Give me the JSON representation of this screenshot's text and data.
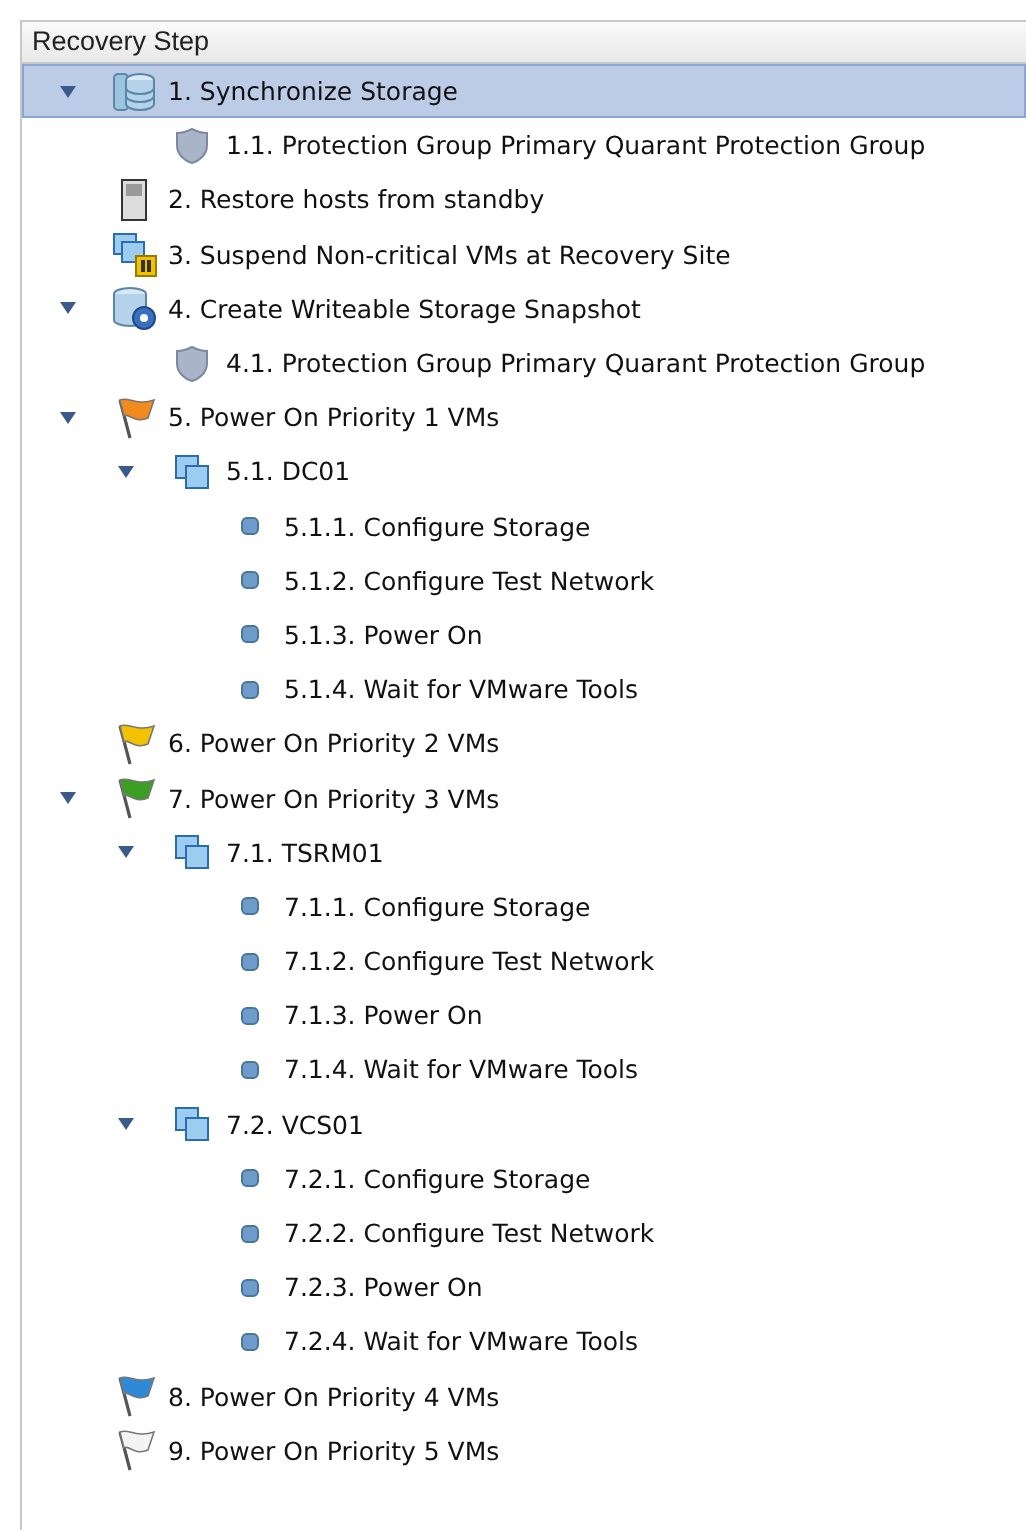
{
  "tree": {
    "column_header": "Recovery Step",
    "items": [
      {
        "label": "1. Synchronize Storage",
        "kind": "storage",
        "selected": true,
        "expanded": true,
        "children": [
          {
            "label": "1.1. Protection Group Primary Quarant Protection Group",
            "kind": "shield",
            "selected": false,
            "expanded": false
          }
        ]
      },
      {
        "label": "2. Restore hosts from standby",
        "kind": "host",
        "selected": false,
        "expanded": false
      },
      {
        "label": "3. Suspend Non-critical VMs at Recovery Site",
        "kind": "suspend",
        "selected": false,
        "expanded": false
      },
      {
        "label": "4. Create Writeable Storage Snapshot",
        "kind": "snapshot",
        "selected": false,
        "expanded": true,
        "children": [
          {
            "label": "4.1. Protection Group Primary Quarant Protection Group",
            "kind": "shield",
            "selected": false,
            "expanded": false
          }
        ]
      },
      {
        "label": "5. Power On Priority 1 VMs",
        "kind": "flag",
        "color": "#f28a1e",
        "selected": false,
        "expanded": true,
        "children": [
          {
            "label": "5.1. DC01",
            "kind": "vm",
            "selected": false,
            "expanded": true,
            "children": [
              {
                "label": "5.1.1. Configure Storage",
                "kind": "step",
                "selected": false,
                "expanded": false
              },
              {
                "label": "5.1.2. Configure Test Network",
                "kind": "step",
                "selected": false,
                "expanded": false
              },
              {
                "label": "5.1.3. Power On",
                "kind": "step",
                "selected": false,
                "expanded": false
              },
              {
                "label": "5.1.4. Wait for VMware Tools",
                "kind": "step",
                "selected": false,
                "expanded": false
              }
            ]
          }
        ]
      },
      {
        "label": "6. Power On Priority 2 VMs",
        "kind": "flag",
        "color": "#f2c200",
        "selected": false,
        "expanded": false
      },
      {
        "label": "7. Power On Priority 3 VMs",
        "kind": "flag",
        "color": "#3c9e22",
        "selected": false,
        "expanded": true,
        "children": [
          {
            "label": "7.1. TSRM01",
            "kind": "vm",
            "selected": false,
            "expanded": true,
            "children": [
              {
                "label": "7.1.1. Configure Storage",
                "kind": "step",
                "selected": false,
                "expanded": false
              },
              {
                "label": "7.1.2. Configure Test Network",
                "kind": "step",
                "selected": false,
                "expanded": false
              },
              {
                "label": "7.1.3. Power On",
                "kind": "step",
                "selected": false,
                "expanded": false
              },
              {
                "label": "7.1.4. Wait for VMware Tools",
                "kind": "step",
                "selected": false,
                "expanded": false
              }
            ]
          },
          {
            "label": "7.2. VCS01",
            "kind": "vm",
            "selected": false,
            "expanded": true,
            "children": [
              {
                "label": "7.2.1. Configure Storage",
                "kind": "step",
                "selected": false,
                "expanded": false
              },
              {
                "label": "7.2.2. Configure Test Network",
                "kind": "step",
                "selected": false,
                "expanded": false
              },
              {
                "label": "7.2.3. Power On",
                "kind": "step",
                "selected": false,
                "expanded": false
              },
              {
                "label": "7.2.4. Wait for VMware Tools",
                "kind": "step",
                "selected": false,
                "expanded": false
              }
            ]
          }
        ]
      },
      {
        "label": "8. Power On Priority 4 VMs",
        "kind": "flag",
        "color": "#2e8ad6",
        "selected": false,
        "expanded": false
      },
      {
        "label": "9. Power On Priority 5 VMs",
        "kind": "flag",
        "color": "#f4f4f4",
        "selected": false,
        "expanded": false
      }
    ]
  }
}
